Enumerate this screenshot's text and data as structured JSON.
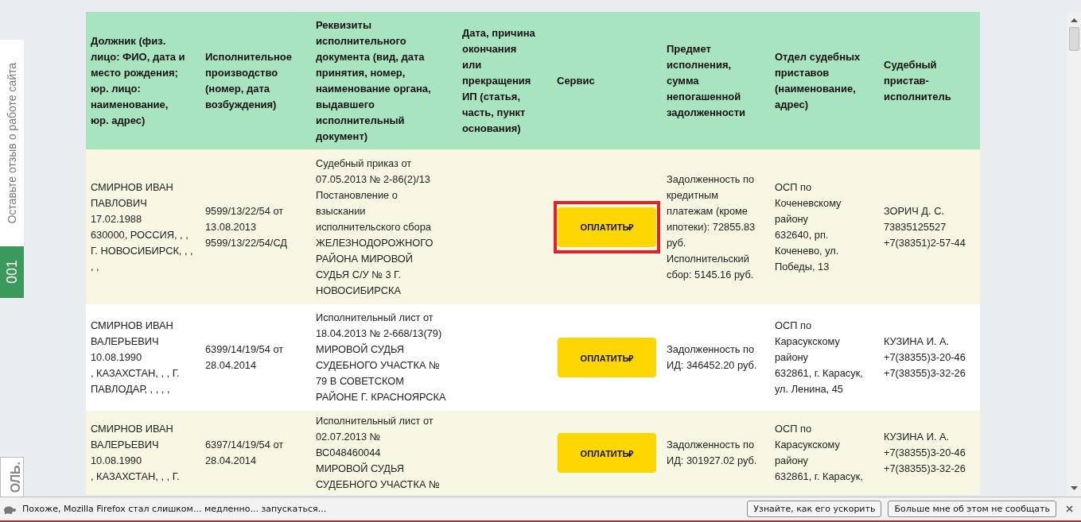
{
  "side_tabs": [
    {
      "label": "Оставьте отзыв о работе сайта",
      "kind": "feedback"
    },
    {
      "label": "001",
      "kind": "counter"
    },
    {
      "label": "ОЛЬ.",
      "kind": "clipped"
    }
  ],
  "table": {
    "columns": [
      "Должник (физ.\nлицо: ФИО, дата и\nместо рождения;\nюр. лицо:\nнаименование,\nюр. адрес)",
      "Исполнительное\nпроизводство\n(номер, дата\nвозбуждения)",
      "Реквизиты\nисполнительного\nдокумента (вид, дата\nпринятия, номер,\nнаименование органа,\nвыдавшего\nисполнительный\nдокумент)",
      "Дата, причина\nокончания\nили\nпрекращения\nИП (статья,\nчасть, пункт\nоснования)",
      "Сервис",
      "Предмет\nисполнения,\nсумма\nнепогашенной\nзадолженности",
      "Отдел судебных\nприставов\n(наименование,\nадрес)",
      "Судебный\nпристав-\nисполнитель"
    ],
    "rows": [
      {
        "debtor": "СМИРНОВ ИВАН\nПАВЛОВИЧ\n17.02.1988\n630000, РОССИЯ, , ,\nГ. НОВОСИБИРСК, , ,\n, ,",
        "proceeding": "9599/13/22/54 от\n13.08.2013\n9599/13/22/54/СД",
        "document": "Судебный приказ от\n07.05.2013 № 2-86(2)/13\nПостановление о\nвзыскании\nисполнительского сбора\nЖЕЛЕЗНОДОРОЖНОГО\nРАЙОНА МИРОВОЙ\nСУДЬЯ С/У № 3 Г.\nНОВОСИБИРСКА",
        "pay_button": "ОПЛАТИТЬ₽",
        "highlighted": true,
        "subject": "Задолженность по\nкредитным\nплатежам (кроме\nипотеки): 72855.83\nруб.\nИсполнительский\nсбор: 5145.16 руб.",
        "department": "ОСП по\nКоченевскому\nрайону\n632640, рп.\nКоченево, ул.\nПобеды, 13",
        "bailiff": "ЗОРИЧ Д. С.\n73835125527\n+7(38351)2-57-44"
      },
      {
        "debtor": "СМИРНОВ ИВАН\nВАЛЕРЬЕВИЧ\n10.08.1990\n, КАЗАХСТАН, , , Г.\nПАВЛОДАР, , , , ,",
        "proceeding": "6399/14/19/54 от\n28.04.2014",
        "document": "Исполнительный лист от\n18.04.2013 № 2-668/13(79)\nМИРОВОЙ СУДЬЯ\nСУДЕБНОГО УЧАСТКА №\n79 В СОВЕТСКОМ\nРАЙОНЕ Г. КРАСНОЯРСКА",
        "pay_button": "ОПЛАТИТЬ₽",
        "highlighted": false,
        "subject": "Задолженность по\nИД: 346452.20 руб.",
        "department": "ОСП по\nКарасукскому\nрайону\n632861, г. Карасук,\nул. Ленина, 45",
        "bailiff": "КУЗИНА И. А.\n+7(38355)3-20-46\n+7(38355)3-32-26"
      },
      {
        "debtor": "СМИРНОВ ИВАН\nВАЛЕРЬЕВИЧ\n10.08.1990\n, КАЗАХСТАН, , , Г.",
        "proceeding": "6397/14/19/54 от\n28.04.2014",
        "document": "Исполнительный лист от\n02.07.2013 №\nВС048460044\nМИРОВОЙ СУДЬЯ\nСУДЕБНОГО УЧАСТКА №",
        "pay_button": "ОПЛАТИТЬ₽",
        "highlighted": false,
        "subject": "Задолженность по\nИД: 301927.02 руб.",
        "department": "ОСП по\nКарасукскому\nрайону\n632861, г. Карасук,",
        "bailiff": "КУЗИНА И. А.\n+7(38355)3-20-46\n+7(38355)3-32-26"
      }
    ]
  },
  "notification": {
    "message": "Похоже, Mozilla Firefox стал слишком... медленно... запускаться...",
    "buttons": [
      "Узнайте, как его ускорить",
      "Больше мне об этом не сообщать"
    ]
  }
}
